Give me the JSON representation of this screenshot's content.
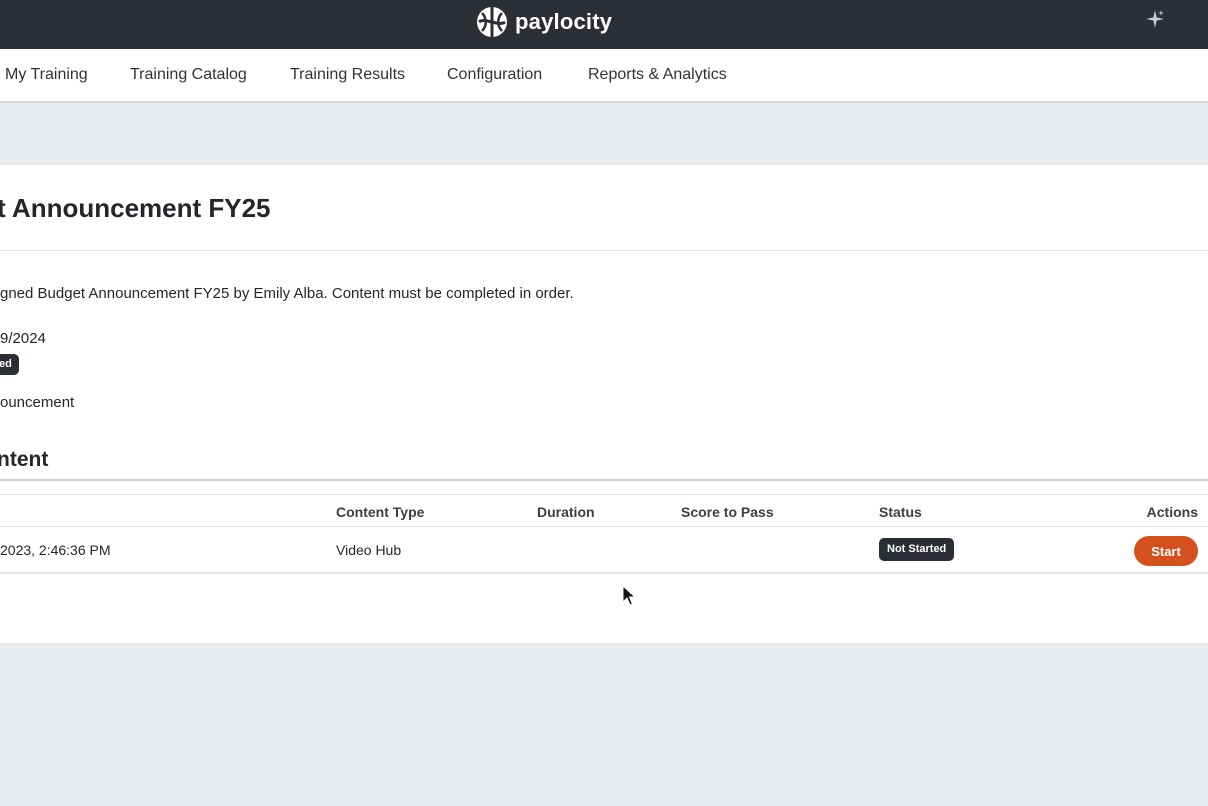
{
  "header": {
    "brand": "paylocity",
    "logo_icon": "paylocity-logo-icon",
    "ai_icon": "sparkle-icon"
  },
  "nav": {
    "items": [
      {
        "label": "My Training"
      },
      {
        "label": "Training Catalog"
      },
      {
        "label": "Training Results"
      },
      {
        "label": "Configuration"
      },
      {
        "label": "Reports & Analytics"
      }
    ]
  },
  "training": {
    "title": "t Announcement FY25",
    "description": "gned Budget Announcement FY25 by Emily Alba. Content must be completed in order.",
    "due_date": "9/2024",
    "status_badge": "ed",
    "category": "ouncement"
  },
  "content_section": {
    "heading": "ntent",
    "columns": [
      "Content Type",
      "Duration",
      "Score to Pass",
      "Status",
      "Actions"
    ],
    "rows": [
      {
        "name": "2023, 2:46:36 PM",
        "content_type": "Video Hub",
        "duration": "",
        "score_to_pass": "",
        "status": "Not Started",
        "action": "Start"
      }
    ]
  },
  "colors": {
    "topbar": "#2b2f35",
    "accent": "#d4511e",
    "badge": "#2b2f35"
  }
}
